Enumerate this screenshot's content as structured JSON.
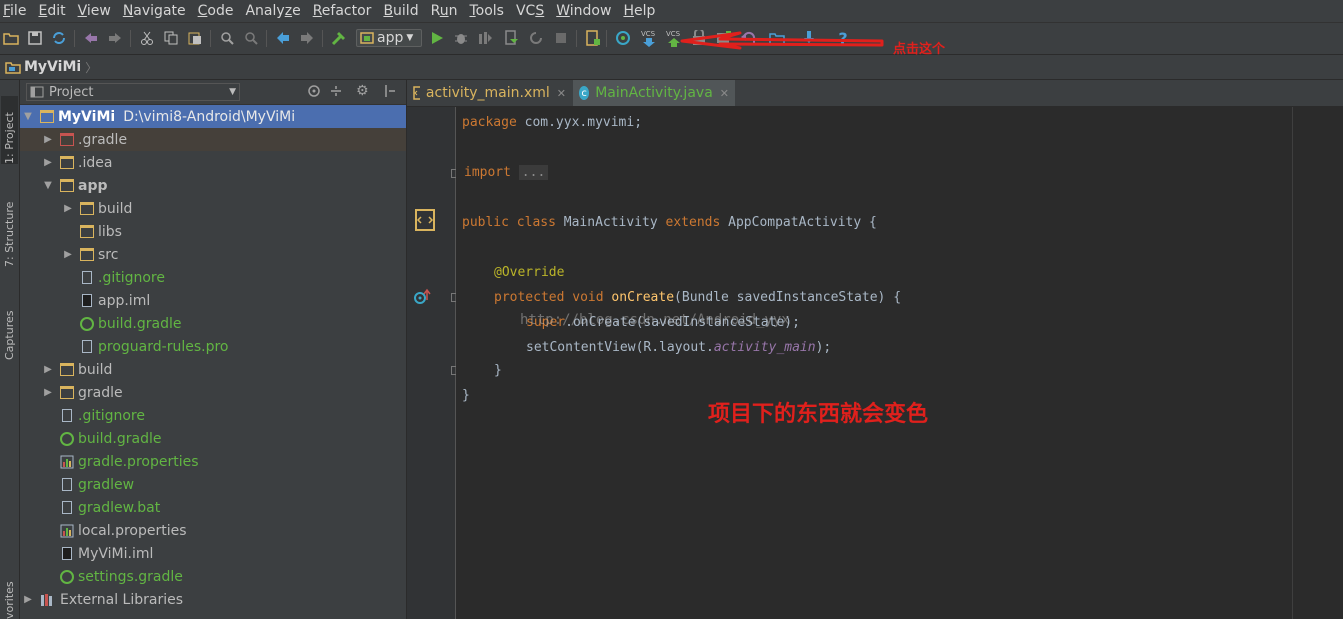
{
  "menu": {
    "items": [
      {
        "pre": "",
        "u": "F",
        "post": "ile"
      },
      {
        "pre": "",
        "u": "E",
        "post": "dit"
      },
      {
        "pre": "",
        "u": "V",
        "post": "iew"
      },
      {
        "pre": "",
        "u": "N",
        "post": "avigate"
      },
      {
        "pre": "",
        "u": "C",
        "post": "ode"
      },
      {
        "pre": "Analy",
        "u": "z",
        "post": "e"
      },
      {
        "pre": "",
        "u": "R",
        "post": "efactor"
      },
      {
        "pre": "",
        "u": "B",
        "post": "uild"
      },
      {
        "pre": "R",
        "u": "u",
        "post": "n"
      },
      {
        "pre": "",
        "u": "T",
        "post": "ools"
      },
      {
        "pre": "VC",
        "u": "S",
        "post": ""
      },
      {
        "pre": "",
        "u": "W",
        "post": "indow"
      },
      {
        "pre": "",
        "u": "H",
        "post": "elp"
      }
    ]
  },
  "toolbar": {
    "run_config": "app",
    "vcs_label": "VCS",
    "annotation": "点击这个"
  },
  "navbar": {
    "project": "MyViMi"
  },
  "side_tabs": {
    "project": "1: Project",
    "structure": "7: Structure",
    "captures": "Captures",
    "favorites": "vorites"
  },
  "project_panel": {
    "title": "Project",
    "root_name": "MyViMi",
    "root_path": "D:\\vimi8-Android\\MyViMi",
    "items": [
      {
        "label": ".gradle"
      },
      {
        "label": ".idea"
      },
      {
        "label": "app"
      },
      {
        "label": "build"
      },
      {
        "label": "libs"
      },
      {
        "label": "src"
      },
      {
        "label": ".gitignore"
      },
      {
        "label": "app.iml"
      },
      {
        "label": "build.gradle"
      },
      {
        "label": "proguard-rules.pro"
      },
      {
        "label": "build"
      },
      {
        "label": "gradle"
      },
      {
        "label": ".gitignore"
      },
      {
        "label": "build.gradle"
      },
      {
        "label": "gradle.properties"
      },
      {
        "label": "gradlew"
      },
      {
        "label": "gradlew.bat"
      },
      {
        "label": "local.properties"
      },
      {
        "label": "MyViMi.iml"
      },
      {
        "label": "settings.gradle"
      },
      {
        "label": "External Libraries"
      }
    ]
  },
  "editor": {
    "tabs": [
      {
        "label": "activity_main.xml"
      },
      {
        "label": "MainActivity.java"
      }
    ],
    "code": {
      "l1_kw": "package",
      "l1_rest": " com.yyx.myvimi;",
      "l2_kw": "import",
      "l2_fold": "...",
      "l3_kw1": "public",
      "l3_kw2": "class",
      "l3_name": " MainActivity ",
      "l3_kw3": "extends",
      "l3_rest": " AppCompatActivity {",
      "l4_ann": "@Override",
      "l5_kw1": "protected",
      "l5_kw2": "void",
      "l5_fn": "onCreate",
      "l5_rest": "(Bundle savedInstanceState) {",
      "l6_kw": "super",
      "l6_rest": ".onCreate(savedInstanceState);",
      "l7_pre": "setContentView(R.layout.",
      "l7_it": "activity_main",
      "l7_post": ");",
      "l8": "}",
      "l9": "}"
    },
    "watermark": "http://blog.csdn.net/Android_yyx",
    "annotation": "项目下的东西就会变色"
  },
  "colors": {
    "annotation_red": "#e0201c",
    "vcs_modified_green": "#62b543",
    "selection_blue": "#4b6eaf"
  }
}
